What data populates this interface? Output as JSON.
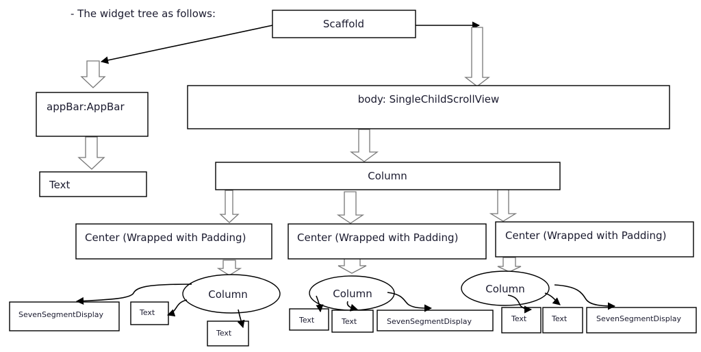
{
  "caption": "- The widget tree as follows:",
  "nodes": {
    "scaffold": "Scaffold",
    "appbar": "appBar:AppBar",
    "appbar_text": "Text",
    "body": "body: SingleChildScrollView",
    "column": "Column",
    "center1": "Center (Wrapped with Padding)",
    "center2": "Center (Wrapped with Padding)",
    "center3": "Center (Wrapped with Padding)",
    "col1": "Column",
    "col2": "Column",
    "col3": "Column",
    "c1_ssd": "SevenSegmentDisplay",
    "c1_text1": "Text",
    "c1_text2": "Text",
    "c2_text1": "Text",
    "c2_text2": "Text",
    "c2_ssd": "SevenSegmentDisplay",
    "c3_text1": "Text",
    "c3_text2": "Text",
    "c3_ssd": "SevenSegmentDisplay"
  }
}
